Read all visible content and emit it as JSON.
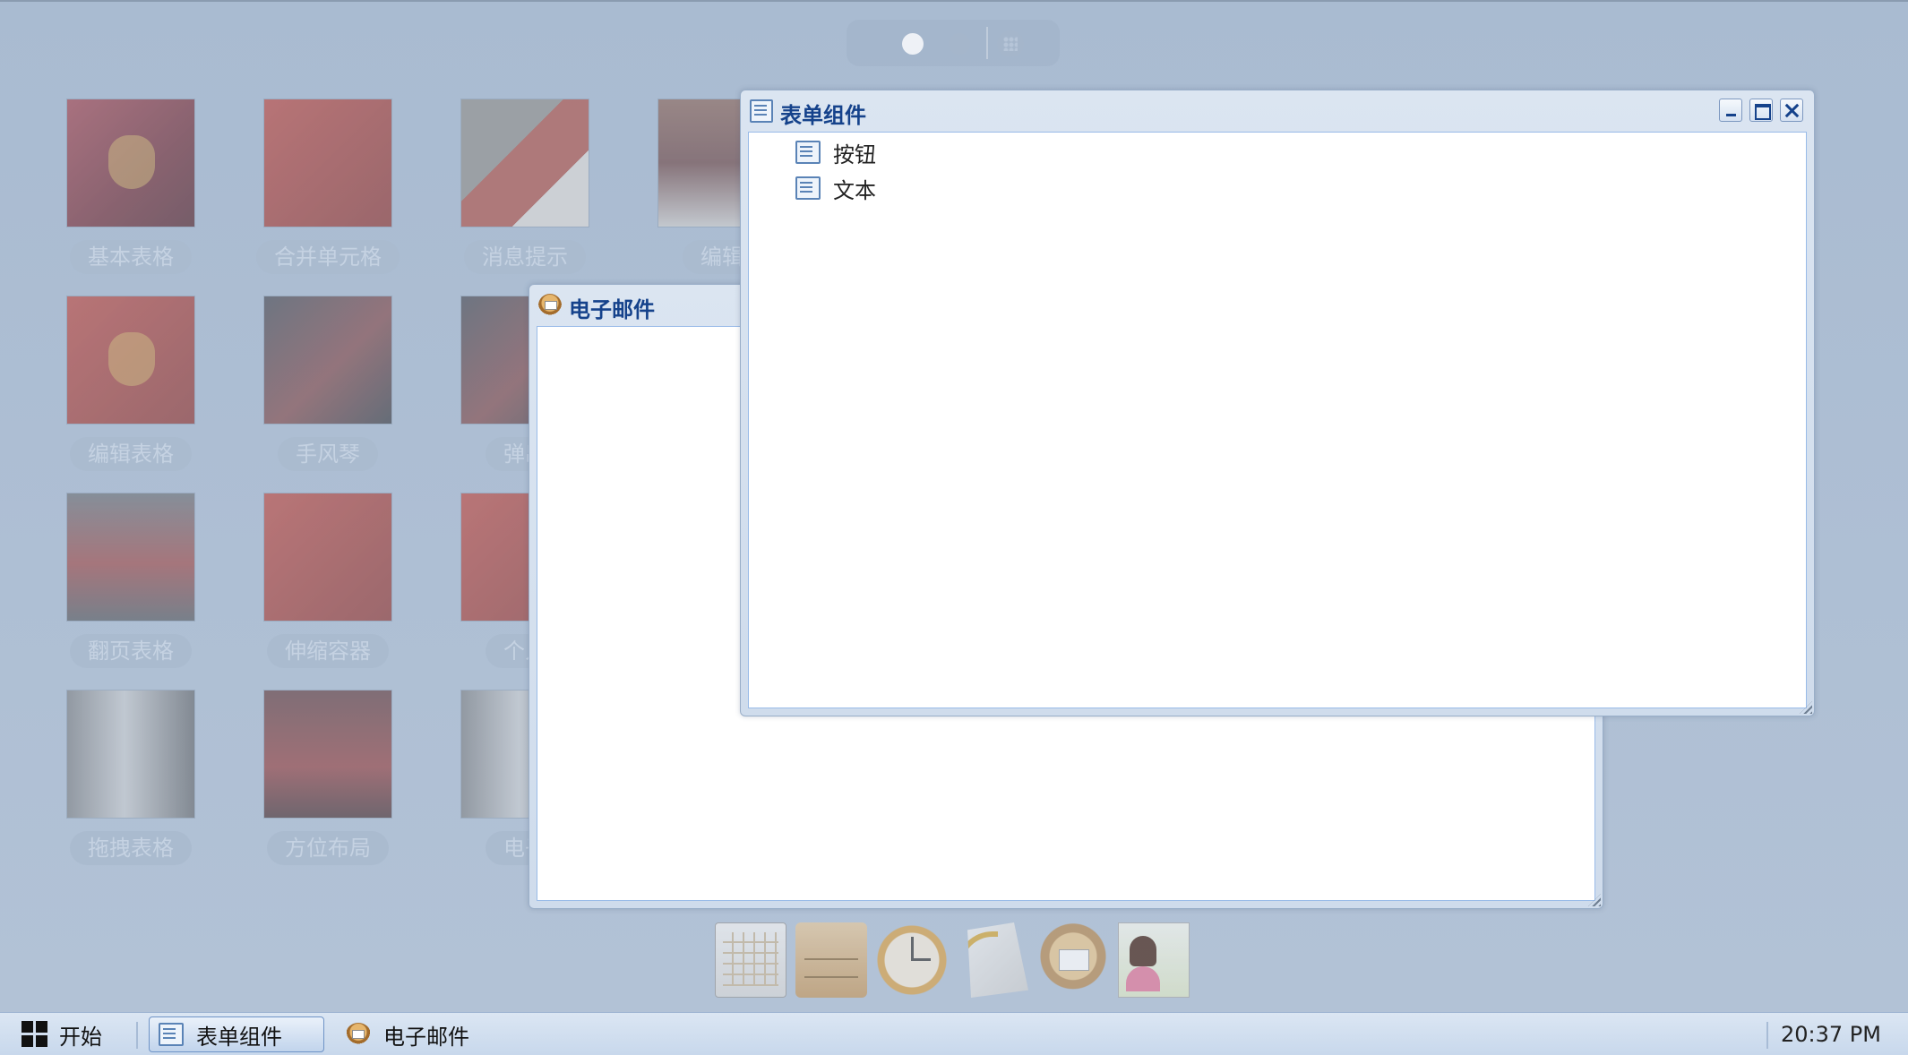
{
  "desktop": {
    "apps": [
      {
        "label": "基本表格"
      },
      {
        "label": "合并单元格"
      },
      {
        "label": "消息提示"
      },
      {
        "label": "编辑"
      },
      {
        "label": "编辑表格"
      },
      {
        "label": "手风琴"
      },
      {
        "label": "弹出"
      },
      {
        "label": "翻页表格"
      },
      {
        "label": "伸缩容器"
      },
      {
        "label": "个人"
      },
      {
        "label": "拖拽表格"
      },
      {
        "label": "方位布局"
      },
      {
        "label": "电子"
      }
    ]
  },
  "windows": {
    "form": {
      "title": "表单组件",
      "items": [
        {
          "label": "按钮"
        },
        {
          "label": "文本"
        }
      ]
    },
    "email": {
      "title": "电子邮件"
    }
  },
  "taskbar": {
    "start_label": "开始",
    "tasks": [
      {
        "label": "表单组件"
      },
      {
        "label": "电子邮件"
      }
    ],
    "clock": "20:37 PM"
  },
  "icons": {
    "form": "list-icon",
    "email": "email-avatar-icon",
    "dock": [
      "calendar-icon",
      "drawer-icon",
      "clock-icon",
      "documents-icon",
      "mail-icon",
      "user-card-icon"
    ]
  }
}
